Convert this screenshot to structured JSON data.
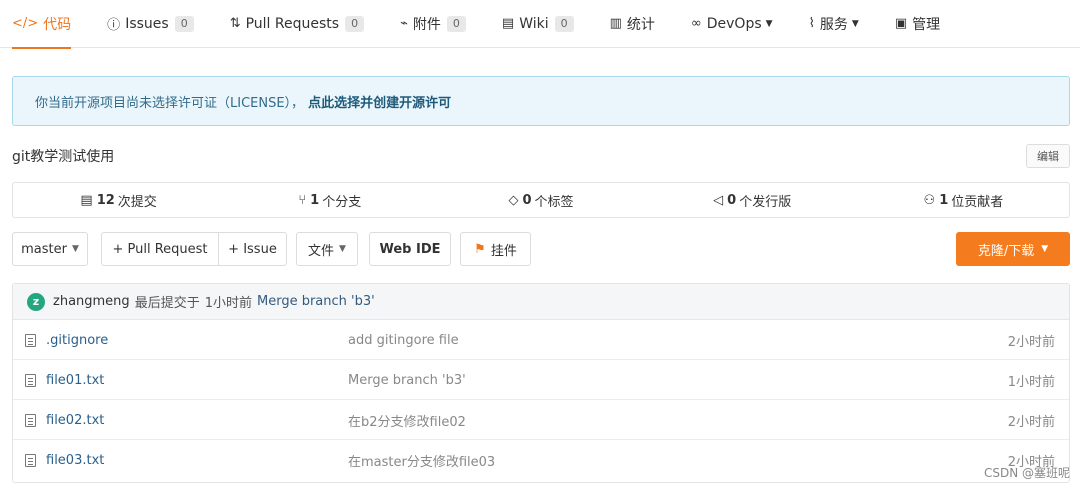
{
  "tabs": [
    {
      "icon": "</>",
      "label": "代码",
      "active": true
    },
    {
      "icon": "ⓘ",
      "label": "Issues",
      "badge": "0"
    },
    {
      "icon": "⇅",
      "label": "Pull Requests",
      "badge": "0"
    },
    {
      "icon": "⌁",
      "label": "附件",
      "badge": "0"
    },
    {
      "icon": "▤",
      "label": "Wiki",
      "badge": "0"
    },
    {
      "icon": "▥",
      "label": "统计"
    },
    {
      "icon": "∞",
      "label": "DevOps",
      "dropdown": true
    },
    {
      "icon": "⌇",
      "label": "服务",
      "dropdown": true
    },
    {
      "icon": "▣",
      "label": "管理"
    }
  ],
  "notice": {
    "text": "你当前开源项目尚未选择许可证（LICENSE），",
    "link": "点此选择并创建开源许可"
  },
  "description": "git教学测试使用",
  "edit_label": "编辑",
  "stats": {
    "commits": {
      "count": "12",
      "label": "次提交"
    },
    "branches": {
      "count": "1",
      "label": "个分支"
    },
    "tags": {
      "count": "0",
      "label": "个标签"
    },
    "releases": {
      "count": "0",
      "label": "个发行版"
    },
    "contributors": {
      "count": "1",
      "label": "位贡献者"
    }
  },
  "toolbar": {
    "branch": "master",
    "pull_request": "+ Pull Request",
    "issue": "+ Issue",
    "files": "文件",
    "web_ide": "Web IDE",
    "widget": "挂件",
    "clone": "克隆/下载"
  },
  "last_commit": {
    "avatar_letter": "z",
    "author": "zhangmeng",
    "prefix": "最后提交于",
    "time": "1小时前",
    "message": "Merge branch 'b3'"
  },
  "files": [
    {
      "name": ".gitignore",
      "message": "add gitingore file",
      "time": "2小时前"
    },
    {
      "name": "file01.txt",
      "message": "Merge branch 'b3'",
      "time": "1小时前"
    },
    {
      "name": "file02.txt",
      "message": "在b2分支修改file02",
      "time": "2小时前"
    },
    {
      "name": "file03.txt",
      "message": "在master分支修改file03",
      "time": "2小时前"
    }
  ],
  "watermark": "CSDN @塞班呢",
  "colors": {
    "accent": "#f0761d",
    "clone_button": "#f57c1e",
    "link": "#2a5f8d"
  }
}
